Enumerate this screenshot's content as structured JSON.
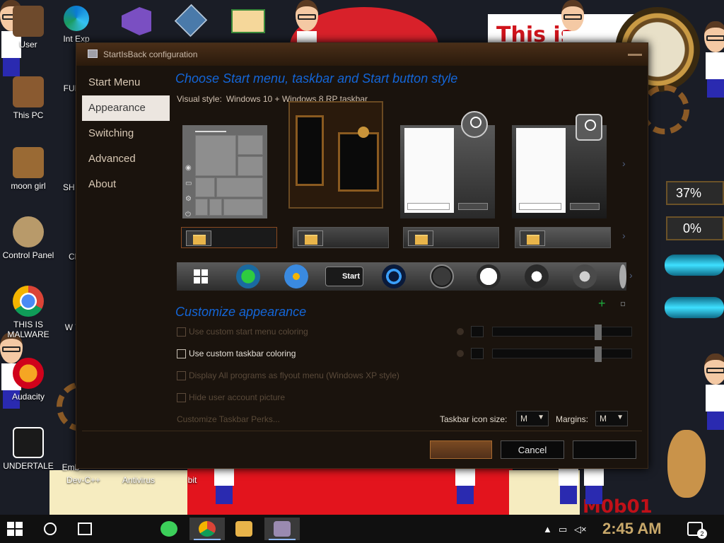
{
  "dialog": {
    "title": "StartIsBack configuration"
  },
  "nav": {
    "items": [
      {
        "label": "Start Menu"
      },
      {
        "label": "Appearance"
      },
      {
        "label": "Switching"
      },
      {
        "label": "Advanced"
      },
      {
        "label": "About"
      }
    ],
    "active": "Appearance"
  },
  "appearance": {
    "heading": "Choose Start menu, taskbar and Start button style",
    "visual_style_label": "Visual style:",
    "visual_style_value": "Windows 10 + Windows 8 RP taskbar",
    "customize_heading": "Customize appearance",
    "options": [
      {
        "label": "Use custom start menu coloring",
        "checked": false,
        "enabled": false
      },
      {
        "label": "Use custom taskbar coloring",
        "checked": false,
        "enabled": true
      },
      {
        "label": "Display All programs as flyout menu (Windows XP style)",
        "checked": false,
        "enabled": false
      },
      {
        "label": "Hide user account picture",
        "checked": false,
        "enabled": false
      }
    ],
    "perks_link": "Customize Taskbar Perks...",
    "icon_size_label": "Taskbar icon size:",
    "icon_size_value": "M",
    "margins_label": "Margins:",
    "margins_value": "M"
  },
  "buttons": {
    "cancel": "Cancel"
  },
  "desktop": {
    "icons": [
      {
        "label": "User"
      },
      {
        "label": "This PC"
      },
      {
        "label": "moon girl"
      },
      {
        "label": "Control Panel"
      },
      {
        "label": "THIS IS MALWARE"
      },
      {
        "label": "Audacity"
      },
      {
        "label": "UNDERTALE"
      },
      {
        "label": "Int Exp"
      },
      {
        "label": "FUR U"
      },
      {
        "label": "SH HO"
      },
      {
        "label": "Cho"
      },
      {
        "label": "W Wri"
      },
      {
        "label": "Emb"
      },
      {
        "label": "Dev-C++"
      },
      {
        "label": "Antivirus"
      },
      {
        "label": "bit"
      }
    ],
    "gauges": [
      "37%",
      "0%"
    ],
    "wallpaper_text_top": "This is ",
    "wallpaper_text_bottom": "M0b01"
  },
  "taskbar": {
    "time": "2:45 AM",
    "notification_count": "2"
  },
  "colors": {
    "accent_heading": "#1466d8",
    "dialog_bg": "#1a130d",
    "nav_active_bg": "#ece6e0",
    "clock": "#c8a86a"
  }
}
